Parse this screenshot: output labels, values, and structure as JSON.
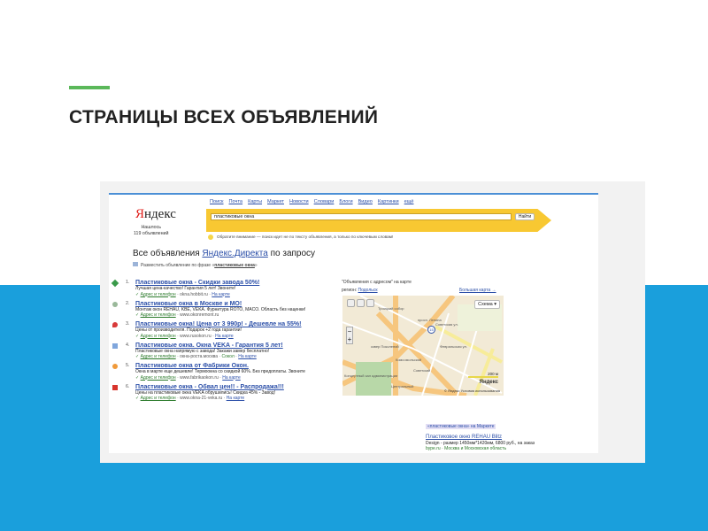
{
  "slide": {
    "title": "СТРАНИЦЫ ВСЕХ ОБЪЯВЛЕНИЙ",
    "colors": {
      "band": "#1a9fdc",
      "accent": "#5bb85a"
    }
  },
  "yandex": {
    "nav": [
      "Поиск",
      "Почта",
      "Карты",
      "Маркет",
      "Новости",
      "Словари",
      "Блоги",
      "Видео",
      "Картинки",
      "ещё"
    ],
    "logo_first": "Я",
    "logo_rest": "ндекс",
    "found_line1": "Нашлось",
    "found_line2": "119 объявлений",
    "search_value": "пластиковые окна",
    "search_button": "Найти",
    "note": "Обратите внимание — поиск идет не по тексту объявления, а только по ключевым словам!",
    "heading_pre": "Все объявления ",
    "heading_link": "Яндекс.Директа",
    "heading_post": " по запросу",
    "place_pre": "Разместить объявление по фразе «",
    "place_phrase": "пластиковые окна",
    "place_post": "»",
    "ads": [
      {
        "num": "1.",
        "icon": "green-diamond-icon",
        "title": "Пластиковые окна - Скидки завода 50%!",
        "desc": "Лучшая цена-качество! Гарантия 5 лет! Звоните!",
        "contact": "Адрес и телефон",
        "site": "okna.hobbit.ru",
        "metro": "",
        "map": "На карте"
      },
      {
        "num": "2.",
        "icon": "pin-icon",
        "title": "Пластиковые окна в Москве и МО!",
        "desc": "Монтаж окон REHAU, KBE, VEKA. Фурнитура ROTO, MACO. Область без наценки!",
        "contact": "Адрес и телефон",
        "site": "www.okonremont.ru",
        "metro": "",
        "map": ""
      },
      {
        "num": "3.",
        "icon": "red-marker-icon",
        "title": "Пластиковые окна! Цена от 3 990р! - Дешевле на 55%!",
        "desc": "Цены от производителя. Подарок +2 года гарантии!",
        "contact": "Адрес и телефон",
        "site": "www.rusokon.ru",
        "metro": "",
        "map": "На карте"
      },
      {
        "num": "4.",
        "icon": "calendar-icon",
        "title": "Пластиковые окна. Окна VEKA - Гарантия 5 лет!",
        "desc": "Пластиковые окна напрямую с завода! Закажи замер бесплатно!",
        "contact": "Адрес и телефон",
        "site": "окна-роста.москва",
        "metro": "Сокол",
        "map": "На карте"
      },
      {
        "num": "5.",
        "icon": "orange-logo-icon",
        "title": "Пластиковые окна от Фабрики Окон.",
        "desc": "Окна в марте еще дешевле! Термоокна со скидкой 60%. Без предоплаты. Звоните",
        "contact": "Адрес и телефон",
        "site": "www.fabrikaokon.ru",
        "metro": "",
        "map": "На карте"
      },
      {
        "num": "6.",
        "icon": "red-21-icon",
        "title": "Пластиковые окна - Обвал цен!! - Распродажа!!!",
        "desc": "Цены на пластиковые окна VEKA обрушились! Скидка 45% - Завод!",
        "contact": "Адрес и телефон",
        "site": "www.okna-21-veka.ru",
        "metro": "",
        "map": "На карте"
      }
    ],
    "map": {
      "heading": "\"Объявления с адресом\" на карте",
      "region_label": "регион: ",
      "region": "Подольск",
      "big_map": "Большая карта →",
      "scheme": "Схема ▾",
      "marker": "15",
      "scale": "200 м",
      "copyright": "© Яндекс  Условия использования",
      "logo": "Яндекс",
      "labels": [
        "Троицкий собор",
        "просп. Ленина",
        "Советская ул.",
        "Февральская ул.",
        "сквер Поколений",
        "Комсомольский",
        "Советский",
        "Центральный",
        "Концертный зал администрации"
      ]
    },
    "market": {
      "tag": "«пластиковые окна» на Маркете",
      "title": "Пластиковое окно REHAU Blitz",
      "desc": "Design - размер 1450мм*1420мм, 6800 руб., на заказ",
      "source": "bype.ru · Москва и Московская область"
    }
  }
}
